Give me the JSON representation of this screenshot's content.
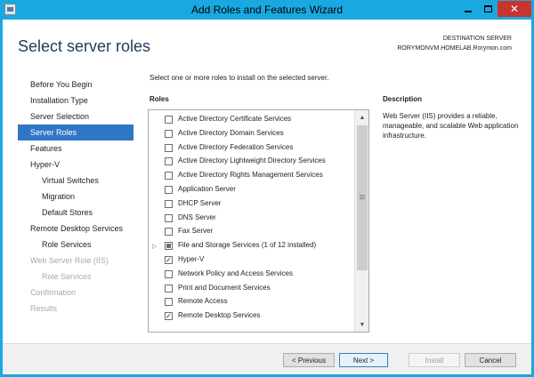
{
  "window": {
    "title": "Add Roles and Features Wizard",
    "close_glyph": "✕"
  },
  "header": {
    "page_title": "Select server roles",
    "destination_label": "DESTINATION SERVER",
    "destination_value": "RORYMONVM.HOMELAB.Rorymon.com"
  },
  "nav": {
    "items": [
      {
        "label": "Before You Begin"
      },
      {
        "label": "Installation Type"
      },
      {
        "label": "Server Selection"
      },
      {
        "label": "Server Roles"
      },
      {
        "label": "Features"
      },
      {
        "label": "Hyper-V"
      },
      {
        "label": "Virtual Switches"
      },
      {
        "label": "Migration"
      },
      {
        "label": "Default Stores"
      },
      {
        "label": "Remote Desktop Services"
      },
      {
        "label": "Role Services"
      },
      {
        "label": "Web Server Role (IIS)"
      },
      {
        "label": "Role Services"
      },
      {
        "label": "Confirmation"
      },
      {
        "label": "Results"
      }
    ]
  },
  "main": {
    "instruction": "Select one or more roles to install on the selected server.",
    "roles_label": "Roles",
    "description_label": "Description",
    "description_text": "Web Server (IIS) provides a reliable, manageable, and scalable Web application infrastructure.",
    "roles": [
      {
        "label": "Active Directory Certificate Services",
        "checked": false
      },
      {
        "label": "Active Directory Domain Services",
        "checked": false
      },
      {
        "label": "Active Directory Federation Services",
        "checked": false
      },
      {
        "label": "Active Directory Lightweight Directory Services",
        "checked": false
      },
      {
        "label": "Active Directory Rights Management Services",
        "checked": false
      },
      {
        "label": "Application Server",
        "checked": false
      },
      {
        "label": "DHCP Server",
        "checked": false
      },
      {
        "label": "DNS Server",
        "checked": false
      },
      {
        "label": "Fax Server",
        "checked": false
      },
      {
        "label": "File and Storage Services (1 of 12 installed)",
        "checked": "partial",
        "expandable": true
      },
      {
        "label": "Hyper-V",
        "checked": true
      },
      {
        "label": "Network Policy and Access Services",
        "checked": false
      },
      {
        "label": "Print and Document Services",
        "checked": false
      },
      {
        "label": "Remote Access",
        "checked": false
      },
      {
        "label": "Remote Desktop Services",
        "checked": true
      }
    ],
    "scrollbar": {
      "up_glyph": "▲",
      "down_glyph": "▼"
    }
  },
  "footer": {
    "previous_label": "< Previous",
    "next_label": "Next >",
    "install_label": "Install",
    "cancel_label": "Cancel"
  },
  "colors": {
    "title_bar": "#19a8e0",
    "close_button": "#c7352e",
    "nav_active": "#3076c6",
    "page_title": "#1e3c5a"
  }
}
